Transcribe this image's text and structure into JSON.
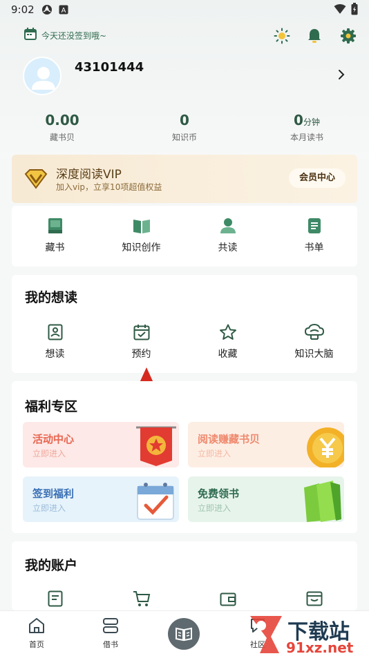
{
  "status_bar": {
    "time": "9:02",
    "icons": [
      "aperture-icon",
      "a-box-icon",
      "wifi-icon",
      "battery-icon"
    ]
  },
  "header": {
    "checkin_text": "今天还没签到哦~",
    "icons": [
      "theme-sun-icon",
      "bell-icon",
      "settings-gear-icon"
    ],
    "accent_color": "#2f6b4f"
  },
  "profile": {
    "user_id": "43101444"
  },
  "stats": [
    {
      "value": "0.00",
      "unit": "",
      "label": "藏书贝"
    },
    {
      "value": "0",
      "unit": "",
      "label": "知识币"
    },
    {
      "value": "0",
      "unit": "分钟",
      "label": "本月读书"
    }
  ],
  "vip": {
    "title": "深度阅读VIP",
    "subtitle": "加入vip，立享10项超值权益",
    "button": "会员中心"
  },
  "shortcuts": [
    {
      "label": "藏书",
      "icon": "book-icon"
    },
    {
      "label": "知识创作",
      "icon": "open-book-icon"
    },
    {
      "label": "共读",
      "icon": "person-icon"
    },
    {
      "label": "书单",
      "icon": "list-doc-icon"
    }
  ],
  "want_read": {
    "title": "我的想读",
    "items": [
      {
        "label": "想读",
        "icon": "id-card-icon"
      },
      {
        "label": "预约",
        "icon": "calendar-check-icon"
      },
      {
        "label": "收藏",
        "icon": "star-icon"
      },
      {
        "label": "知识大脑",
        "icon": "brain-cloud-icon"
      }
    ]
  },
  "benefits": {
    "title": "福利专区",
    "items": [
      {
        "title": "活动中心",
        "sub": "立即进入",
        "bg": "#fde9e7",
        "color": "#e8644f"
      },
      {
        "title": "阅读赚藏书贝",
        "sub": "立即进入",
        "bg": "#fdeee4",
        "color": "#ef8a6f"
      },
      {
        "title": "签到福利",
        "sub": "立即进入",
        "bg": "#e6f3fb",
        "color": "#3a6fb4"
      },
      {
        "title": "免费领书",
        "sub": "立即进入",
        "bg": "#e7f4ec",
        "color": "#2f6b4f"
      }
    ]
  },
  "account": {
    "title": "我的账户",
    "icons": [
      "document-edit-icon",
      "cart-icon",
      "wallet-icon",
      "card-box-icon"
    ]
  },
  "bottom_nav": [
    {
      "label": "首页",
      "icon": "home-icon"
    },
    {
      "label": "借书",
      "icon": "stack-icon"
    },
    {
      "label": "",
      "icon": "reader-book-icon"
    },
    {
      "label": "社区",
      "icon": "chat-icon"
    }
  ],
  "watermark": {
    "line1": "下载站",
    "line2": "91xz.net"
  }
}
